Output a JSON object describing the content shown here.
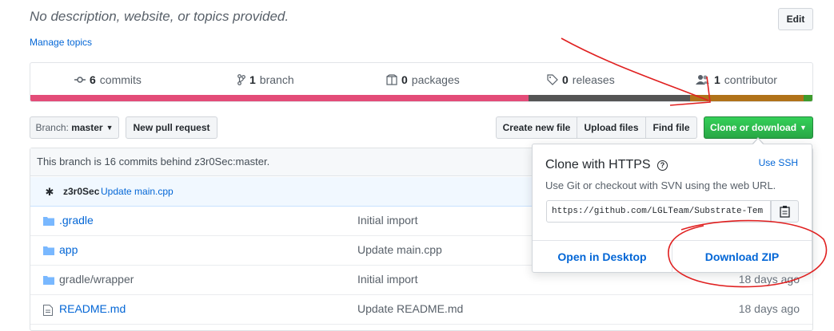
{
  "repo": {
    "description": "No description, website, or topics provided.",
    "manage_topics": "Manage topics",
    "edit_label": "Edit"
  },
  "summary": {
    "commits": {
      "count": "6",
      "label": "commits",
      "icon": "commit-icon"
    },
    "branches": {
      "count": "1",
      "label": "branch",
      "icon": "branch-icon"
    },
    "packages": {
      "count": "0",
      "label": "packages",
      "icon": "package-icon"
    },
    "releases": {
      "count": "0",
      "label": "releases",
      "icon": "tag-icon"
    },
    "contributors": {
      "count": "1",
      "label": "contributor",
      "icon": "people-icon"
    },
    "language_bar": [
      {
        "color": "#e34c78",
        "fraction": 0.637
      },
      {
        "color": "#555555",
        "fraction": 0.207
      },
      {
        "color": "#b07219",
        "fraction": 0.145
      },
      {
        "color": "#3e9b2c",
        "fraction": 0.011
      }
    ]
  },
  "toolbar": {
    "branch_prefix": "Branch:",
    "branch_name": "master",
    "new_pull_request": "New pull request",
    "create_new_file": "Create new file",
    "upload_files": "Upload files",
    "find_file": "Find file",
    "clone_or_download": "Clone or download"
  },
  "files": {
    "behind_notice": "This branch is 16 commits behind z3r0Sec:master.",
    "latest_commit": {
      "author": "z3r0Sec",
      "message": "Update main.cpp"
    },
    "rows": [
      {
        "name": ".gradle",
        "message": "Initial import",
        "age": ""
      },
      {
        "name": "app",
        "message": "Update main.cpp",
        "age": ""
      },
      {
        "name": "gradle/wrapper",
        "message": "Initial import",
        "age": "18 days ago"
      },
      {
        "name": "README.md",
        "message": "Update README.md",
        "age": "18 days ago"
      }
    ]
  },
  "clone_popover": {
    "title": "Clone with HTTPS",
    "use_ssh": "Use SSH",
    "help": "Use Git or checkout with SVN using the web URL.",
    "url": "https://github.com/LGLTeam/Substrate-Tem",
    "open_in_desktop": "Open in Desktop",
    "download_zip": "Download ZIP"
  }
}
